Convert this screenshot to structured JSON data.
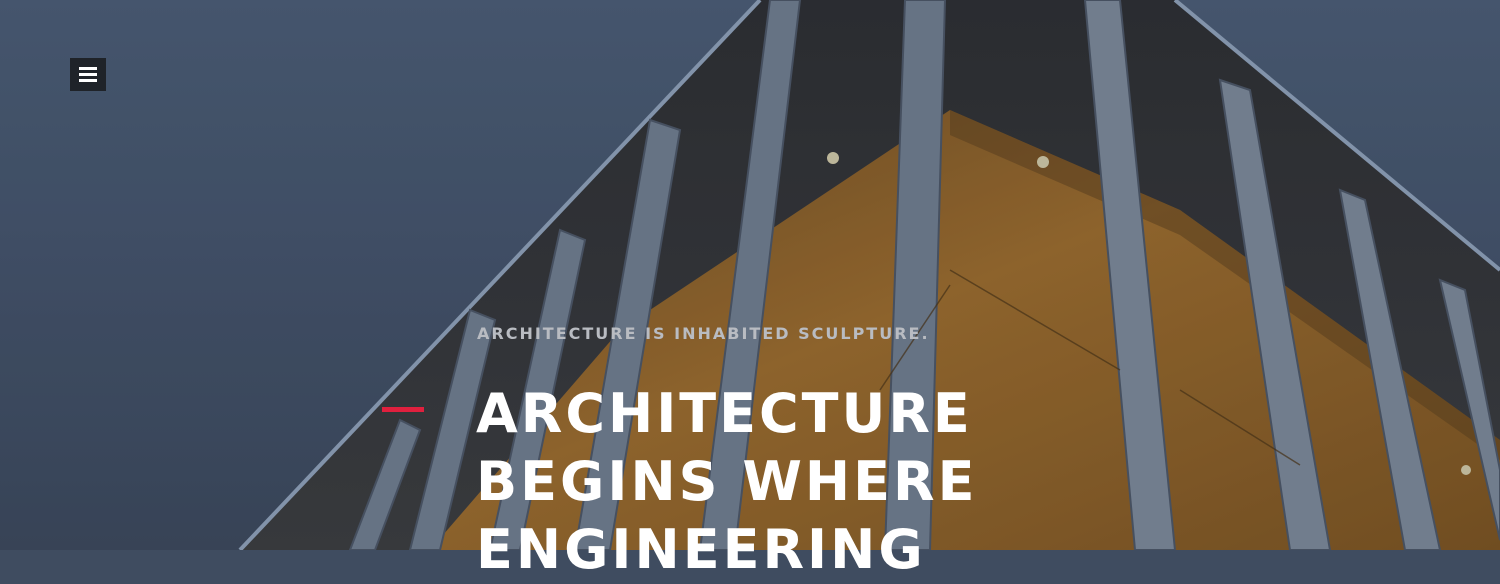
{
  "menu": {
    "icon": "hamburger-menu-icon"
  },
  "hero": {
    "tagline": "ARCHITECTURE IS INHABITED SCULPTURE.",
    "headline_lines": [
      "ARCHITECTURE",
      "BEGINS WHERE",
      "ENGINEERING"
    ],
    "accent_color": "#e0203e"
  }
}
